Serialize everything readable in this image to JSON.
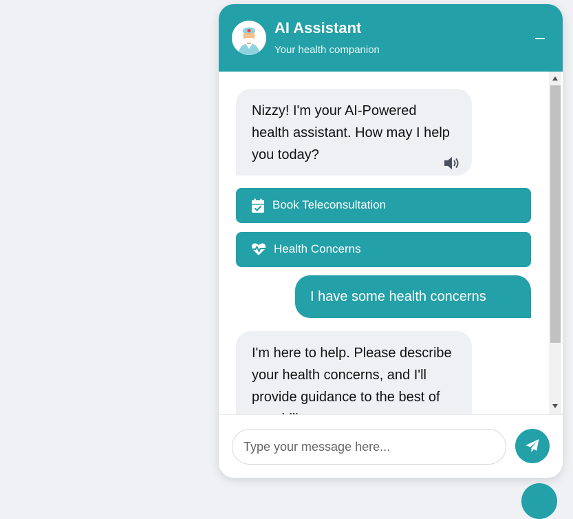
{
  "colors": {
    "accent": "#23a0a8",
    "bot_bubble": "#eff0f4",
    "page_bg": "#eff1f5"
  },
  "header": {
    "title": "AI Assistant",
    "subtitle": "Your health companion",
    "avatar_icon": "doctor-avatar-icon",
    "minimize_icon": "minimize-icon"
  },
  "messages": [
    {
      "sender": "bot",
      "text": "Nizzy! I'm your AI-Powered health assistant. How may I help you today?",
      "icon": "speaker-icon"
    },
    {
      "sender": "user",
      "text": "I have some health concerns"
    },
    {
      "sender": "bot",
      "text": "I'm here to help. Please describe your health concerns, and I'll provide guidance to the best of my ability."
    }
  ],
  "quick_actions": [
    {
      "label": "Book Teleconsultation",
      "icon": "calendar-check-icon"
    },
    {
      "label": "Health Concerns",
      "icon": "heart-pulse-icon"
    }
  ],
  "input": {
    "placeholder": "Type your message here...",
    "value": ""
  },
  "send_icon": "paper-plane-icon"
}
